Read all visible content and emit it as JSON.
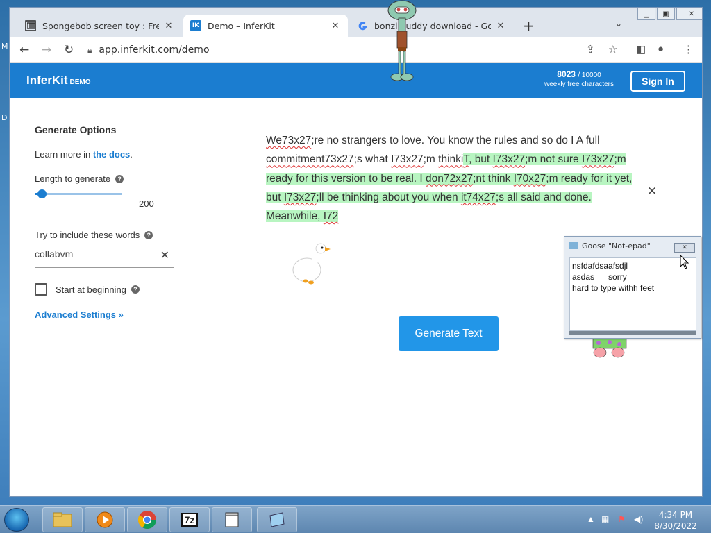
{
  "desktop": {
    "left_labels": [
      "M",
      "D"
    ]
  },
  "browser": {
    "tabs": [
      {
        "title": "Spongebob screen toy : Free Dov",
        "favicon": "archive-icon",
        "active": false
      },
      {
        "title": "Demo – InferKit",
        "favicon": "inferkit-icon",
        "favicon_text": "IK",
        "active": true
      },
      {
        "title": "bonzi buddy download - Google",
        "favicon": "google-icon",
        "active": false
      }
    ],
    "new_tab": "+",
    "url": "app.inferkit.com/demo"
  },
  "page": {
    "logo": "InferKit",
    "logo_tag": "DEMO",
    "char_count": "8023",
    "char_limit": "/ 10000",
    "char_label": "weekly free characters",
    "sign_in": "Sign In",
    "options": {
      "heading": "Generate Options",
      "learn_prefix": "Learn more in ",
      "learn_link": "the docs",
      "learn_suffix": ".",
      "length_label": "Length to generate",
      "length_value": "200",
      "length_fraction": 0.08,
      "words_label": "Try to include these words",
      "words_value": "collabvm",
      "start_label": "Start at beginning",
      "start_checked": false,
      "advanced": "Advanced Settings »"
    },
    "story": {
      "plain": [
        {
          "t": "We73x27",
          "sq": true
        },
        {
          "t": ";re no strangers to love. You know the rules and so do I A full ",
          "sq": false
        },
        {
          "t": "commitment73x27",
          "sq": true
        },
        {
          "t": ";s what ",
          "sq": false
        },
        {
          "t": "I73x27",
          "sq": true
        },
        {
          "t": ";m ",
          "sq": false
        },
        {
          "t": "thinki",
          "sq": true
        }
      ],
      "generated": [
        {
          "t": "T",
          "sq": true
        },
        {
          "t": ", but ",
          "sq": false
        },
        {
          "t": "I73x27",
          "sq": true
        },
        {
          "t": ";m not sure ",
          "sq": false
        },
        {
          "t": "I73x27",
          "sq": true
        },
        {
          "t": ";m ready for this version to be real. I ",
          "sq": false
        },
        {
          "t": "don72x27",
          "sq": true
        },
        {
          "t": ";nt think ",
          "sq": false
        },
        {
          "t": "I70x27",
          "sq": true
        },
        {
          "t": ";m ready for it yet, but ",
          "sq": false
        },
        {
          "t": "I73x27",
          "sq": true
        },
        {
          "t": ";ll be thinking about you when ",
          "sq": false
        },
        {
          "t": "it74x27",
          "sq": true
        },
        {
          "t": ";s all said and done. Meanwhile, ",
          "sq": false
        },
        {
          "t": "I72",
          "sq": true
        }
      ]
    },
    "generate_button": "Generate Text"
  },
  "notepad": {
    "title": "Goose \"Not-epad\"",
    "text": "nsfdafdsaafsdjl\nasdas      sorry\nhard to type withh feet"
  },
  "taskbar": {
    "apps": [
      "explorer-icon",
      "media-player-icon",
      "chrome-icon",
      "7zip-icon",
      "window-icon",
      "notepad-icon"
    ],
    "app_7z_label": "7z",
    "time": "4:34 PM",
    "date": "8/30/2022"
  }
}
